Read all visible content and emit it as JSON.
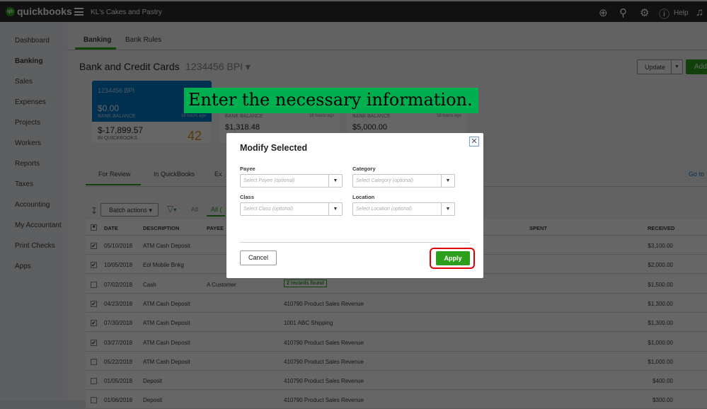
{
  "topbar": {
    "brand": "quickbooks",
    "company": "KL's Cakes and Pastry",
    "help": "Help"
  },
  "sidebar": {
    "items": [
      "Dashboard",
      "Banking",
      "Sales",
      "Expenses",
      "Projects",
      "Workers",
      "Reports",
      "Taxes",
      "Accounting",
      "My Accountant",
      "Print Checks",
      "Apps"
    ],
    "active": "Banking"
  },
  "tabs": [
    "Banking",
    "Bank Rules"
  ],
  "page": {
    "title": "Bank and Credit Cards",
    "account": "1234456 BPI",
    "update": "Update",
    "add": "Add"
  },
  "cards": [
    {
      "name": "1234456 BPI",
      "bank_balance": "$0.00",
      "bank_label": "BANK BALANCE",
      "updated": "18 hours ago",
      "qb_balance": "$-17,899.57",
      "qb_label": "IN QUICKBOOKS",
      "count": "42"
    },
    {
      "bank_label": "BANK BALANCE",
      "updated": "18 hours ago",
      "bank_balance": "$1,318.48"
    },
    {
      "bank_label": "BANK BALANCE",
      "updated": "18 hours ago",
      "bank_balance": "$5,000.00"
    }
  ],
  "subtabs": [
    "For Review",
    "In QuickBooks",
    "Ex"
  ],
  "goto": "Go to",
  "toolbar": {
    "batch": "Batch actions",
    "all": "All",
    "all_tab": "All ("
  },
  "table": {
    "headers": [
      "DATE",
      "DESCRIPTION",
      "PAYEE",
      "",
      "SPENT",
      "RECEIVED"
    ],
    "rows": [
      {
        "checked": true,
        "date": "05/10/2018",
        "desc": "ATM Cash Deposit",
        "payee": "",
        "cat": "",
        "received": "$3,100.00"
      },
      {
        "checked": true,
        "date": "10/05/2018",
        "desc": "Eol Mobile Bnkg",
        "payee": "",
        "cat": "",
        "received": "$2,000.00"
      },
      {
        "checked": false,
        "date": "07/02/2018",
        "desc": "Cash",
        "payee": "A Customer",
        "cat": "2 records found",
        "received": "$1,500.00"
      },
      {
        "checked": true,
        "date": "04/23/2018",
        "desc": "ATM Cash Deposit",
        "payee": "",
        "cat": "410790 Product Sales Revenue",
        "received": "$1,300.00"
      },
      {
        "checked": true,
        "date": "07/30/2018",
        "desc": "ATM Cash Deposit",
        "payee": "",
        "cat": "1001 ABC Shipping",
        "received": "$1,300.00"
      },
      {
        "checked": true,
        "date": "03/27/2018",
        "desc": "ATM Cash Deposit",
        "payee": "",
        "cat": "410790 Product Sales Revenue",
        "received": "$1,000.00"
      },
      {
        "checked": false,
        "date": "05/22/2018",
        "desc": "ATM Cash Deposit",
        "payee": "",
        "cat": "410790 Product Sales Revenue",
        "received": "$1,000.00"
      },
      {
        "checked": false,
        "date": "01/05/2018",
        "desc": "Deposit",
        "payee": "",
        "cat": "410790 Product Sales Revenue",
        "received": "$400.00"
      },
      {
        "checked": false,
        "date": "01/06/2018",
        "desc": "Deposit",
        "payee": "",
        "cat": "410790 Product Sales Revenue",
        "received": "$300.00"
      }
    ]
  },
  "callout": "Enter the necessary information.",
  "modal": {
    "title": "Modify Selected",
    "payee_label": "Payee",
    "payee_ph": "Select Payee (optional)",
    "category_label": "Category",
    "category_ph": "Select Category (optional)",
    "class_label": "Class",
    "class_ph": "Select Class (optional)",
    "location_label": "Location",
    "location_ph": "Select Location (optional)",
    "cancel": "Cancel",
    "apply": "Apply"
  },
  "colors": {
    "brand_green": "#2ca01c",
    "callout_green": "#00b050",
    "highlight_red": "#e00000",
    "card_blue": "#0077c5"
  }
}
